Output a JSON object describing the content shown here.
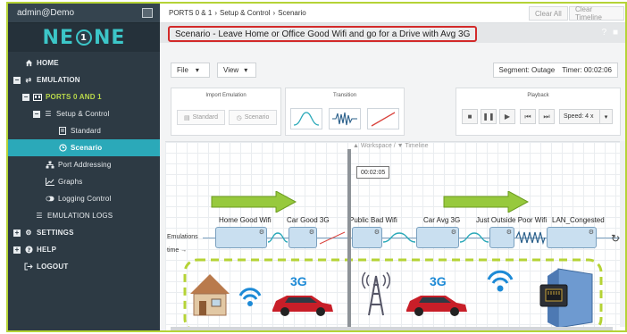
{
  "user": "admin@Demo",
  "logo": {
    "left": "NE",
    "badge": "1",
    "right": "NE"
  },
  "nav": [
    {
      "label": "HOME",
      "icon": "home-icon"
    },
    {
      "label": "EMULATION",
      "icon": "emulation-icon"
    },
    {
      "label": "PORTS 0 AND 1",
      "icon": "ports-icon"
    },
    {
      "label": "Setup & Control",
      "icon": "sliders-icon"
    },
    {
      "label": "Standard",
      "icon": "document-icon"
    },
    {
      "label": "Scenario",
      "icon": "clock-icon"
    },
    {
      "label": "Port Addressing",
      "icon": "network-icon"
    },
    {
      "label": "Graphs",
      "icon": "graph-icon"
    },
    {
      "label": "Logging Control",
      "icon": "toggle-icon"
    },
    {
      "label": "EMULATION LOGS",
      "icon": "list-icon"
    },
    {
      "label": "SETTINGS",
      "icon": "gears-icon"
    },
    {
      "label": "HELP",
      "icon": "help-icon"
    },
    {
      "label": "LOGOUT",
      "icon": "logout-icon"
    }
  ],
  "breadcrumb": {
    "part1": "PORTS 0 & 1",
    "part2": "Setup & Control",
    "part3": "Scenario"
  },
  "top_buttons": {
    "clear_all": "Clear All",
    "clear_timeline": "Clear Timeline"
  },
  "scenario_title": "Scenario - Leave Home or Office Good Wifi and go for a Drive with Avg 3G",
  "toolbar": {
    "file": "File",
    "view": "View",
    "segment": "Segment: Outage",
    "timer": "Timer: 00:02:06"
  },
  "import_panel": {
    "title": "Import Emulation",
    "standard": "Standard",
    "scenario": "Scenario"
  },
  "transition_panel": {
    "title": "Transition"
  },
  "playback_panel": {
    "title": "Playback",
    "speed": "Speed: 4 x"
  },
  "workspace_label": "▲ Workspace / ▼ Timeline",
  "time_bubble": "00:02:05",
  "row_labels": {
    "emulations": "Emulations",
    "time": "time →"
  },
  "segments": [
    "Home Good Wifi",
    "Car Good 3G",
    "Public Bad Wifi",
    "Car Avg 3G",
    "Just Outside Poor Wifi",
    "LAN_Congested"
  ],
  "illustration": {
    "net1": "3G",
    "net2": "3G"
  },
  "colors": {
    "accent": "#2ba9b9",
    "lime": "#b5d336",
    "highlight": "#d22a2a"
  }
}
